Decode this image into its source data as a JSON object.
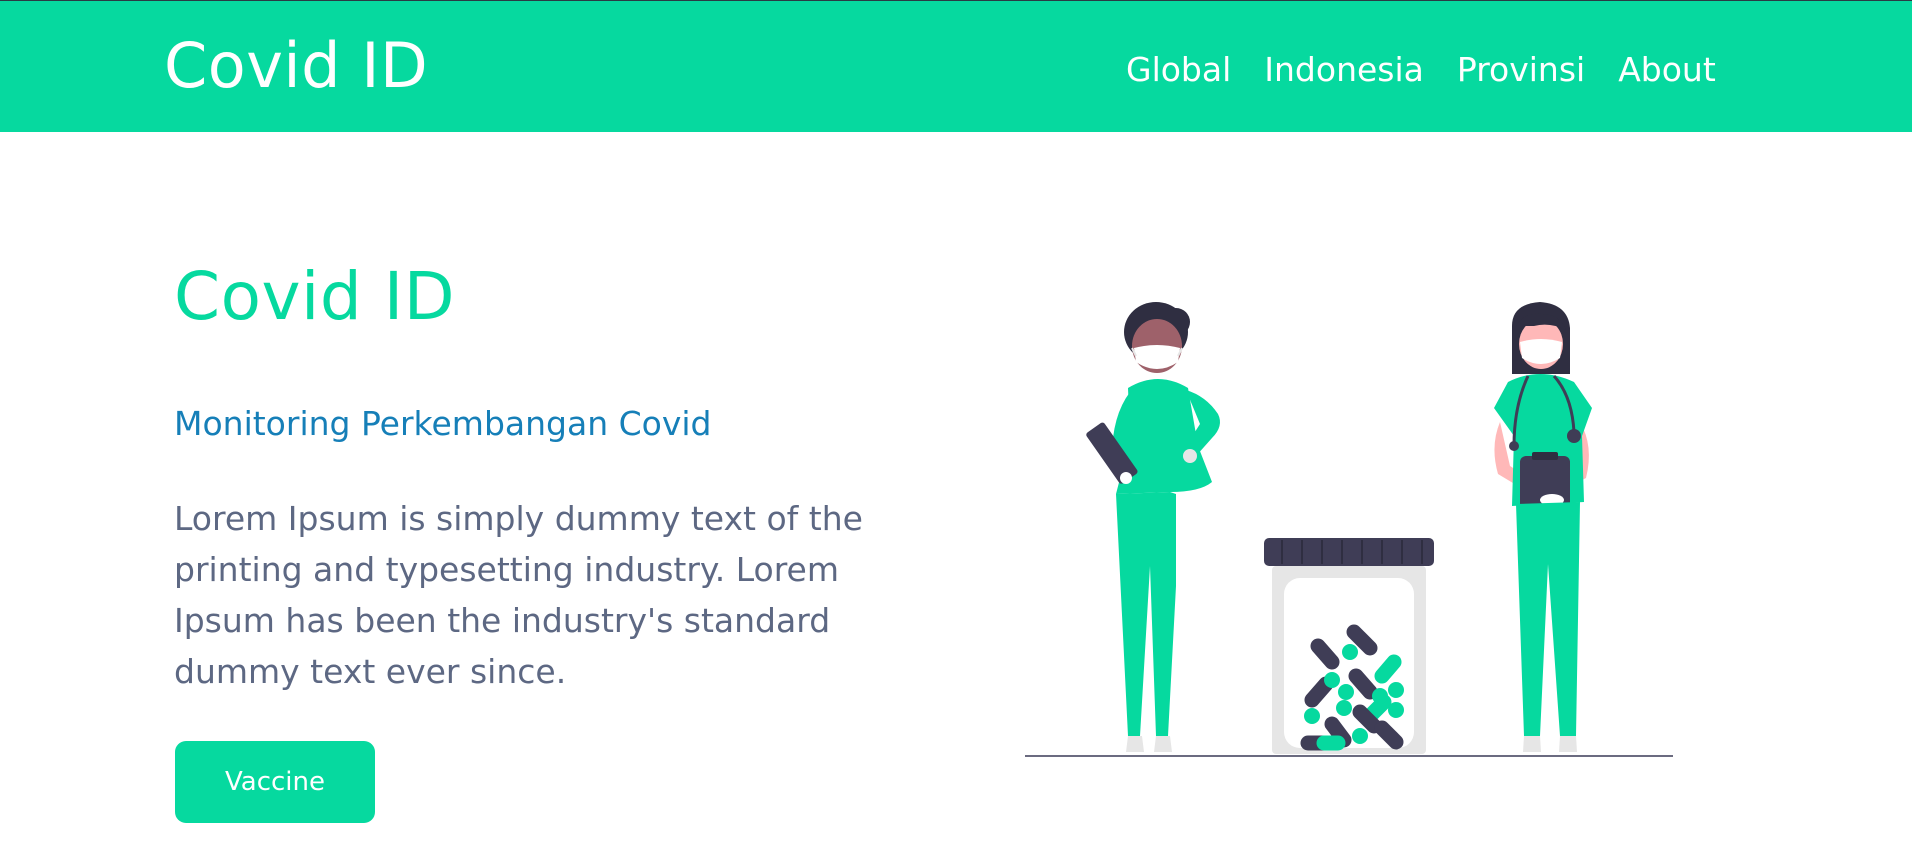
{
  "navbar": {
    "brand": "Covid ID",
    "links": [
      "Global",
      "Indonesia",
      "Provinsi",
      "About"
    ]
  },
  "hero": {
    "title": "Covid ID",
    "subtitle": "Monitoring Perkembangan Covid",
    "body": "Lorem Ipsum is simply dummy text of the printing and typesetting industry. Lorem Ipsum has been the industry's standard dummy text ever since.",
    "button_label": "Vaccine"
  },
  "illustration": {
    "icon": "medical-staff-illustration"
  },
  "colors": {
    "accent": "#06d99f",
    "subtitle": "#167fb8",
    "body_text": "#5d6883",
    "dark": "#3f3d56"
  }
}
